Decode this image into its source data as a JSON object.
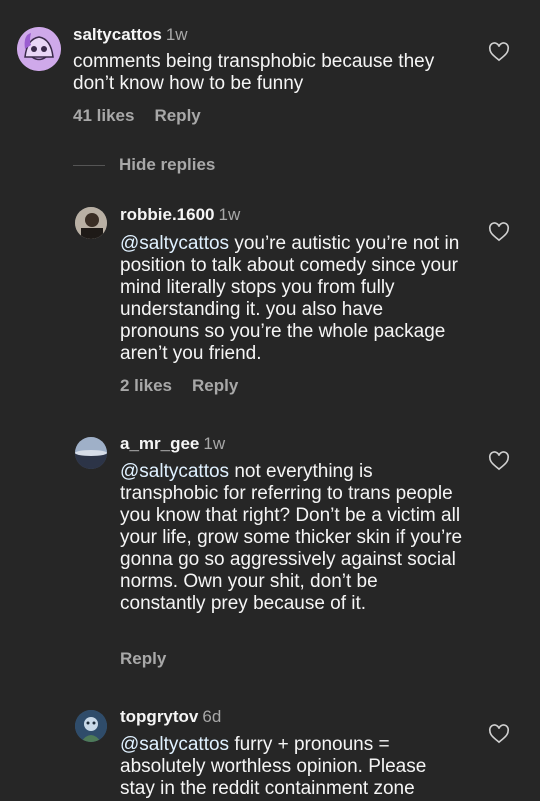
{
  "comments": [
    {
      "username": "saltycattos",
      "time": "1w",
      "mention": "",
      "text": "comments being transphobic because they don’t know how to be funny",
      "likes": "41 likes",
      "reply": "Reply"
    },
    {
      "username": "robbie.1600",
      "time": "1w",
      "mention": "@saltycattos",
      "text": " you’re autistic you’re not in position to talk about comedy since your mind literally stops you from fully understanding it. you also have pronouns so you’re the whole package aren’t you friend.",
      "likes": "2 likes",
      "reply": "Reply"
    },
    {
      "username": "a_mr_gee",
      "time": "1w",
      "mention": "@saltycattos",
      "text": " not everything is transphobic for referring to trans people you know that right? Don’t be a victim all your life, grow some thicker skin if you’re gonna go so aggressively against social norms. Own your shit, don’t be constantly prey because of it.",
      "likes": "",
      "reply": "Reply"
    },
    {
      "username": "topgrytov",
      "time": "6d",
      "mention": "@saltycattos",
      "text": " furry + pronouns = absolutely worthless opinion. Please stay in the reddit containment zone",
      "likes": "",
      "reply": ""
    }
  ],
  "hide_replies": "Hide replies",
  "colors": {
    "background": "#262626",
    "secondary_text": "#a8a8a8",
    "mention": "#e0f1ff"
  }
}
